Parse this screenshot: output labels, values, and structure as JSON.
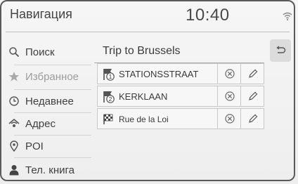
{
  "header": {
    "title": "Навигация",
    "time": "10:40",
    "status_icon": "wifi-icon"
  },
  "sidebar": {
    "items": [
      {
        "label": "Поиск",
        "icon": "search-icon",
        "enabled": true
      },
      {
        "label": "Избранное",
        "icon": "star-icon",
        "enabled": false
      },
      {
        "label": "Недавнее",
        "icon": "clock-icon",
        "enabled": true
      },
      {
        "label": "Адрес",
        "icon": "address-icon",
        "enabled": true
      },
      {
        "label": "POI",
        "icon": "pin-icon",
        "enabled": true
      },
      {
        "label": "Тел. книга",
        "icon": "contact-icon",
        "enabled": true
      }
    ]
  },
  "trip": {
    "title": "Trip to Brussels",
    "back_icon": "back-arrow-icon",
    "destinations": [
      {
        "name": "STATIONSSTRAAT",
        "marker": "1",
        "icon": "waypoint-flag-icon"
      },
      {
        "name": "KERKLAAN",
        "marker": "2",
        "icon": "waypoint-flag-icon"
      },
      {
        "name": "Rue de la Loi",
        "marker": "",
        "icon": "checkered-flag-icon"
      }
    ],
    "row_actions": {
      "delete_icon": "delete-icon",
      "edit_icon": "pencil-icon"
    }
  },
  "colors": {
    "background": "#f0f0f0",
    "text": "#3b3b3b",
    "disabled_text": "#9c9c9c",
    "border": "#c8c8c8"
  }
}
